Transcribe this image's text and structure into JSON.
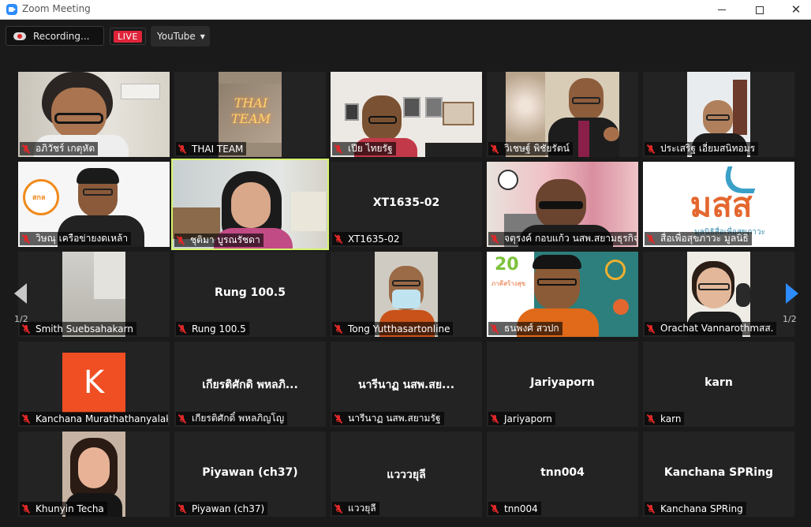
{
  "window": {
    "title": "Zoom Meeting"
  },
  "toolbar": {
    "recording": "Recording...",
    "live": "LIVE",
    "platform": "YouTube"
  },
  "pagination": {
    "left": "1/2",
    "right": "1/2"
  },
  "colors": {
    "active_speaker": "#d6f46b",
    "muted_mic": "#e02828",
    "live_badge": "#e0243a",
    "next_arrow": "#2d8cff"
  },
  "tiles": [
    {
      "name": "อภิวัชร์ เกตุหัต",
      "center": ""
    },
    {
      "name": "THAI TEAM",
      "center": ""
    },
    {
      "name": "เปีย ไทยรัฐ",
      "center": ""
    },
    {
      "name": "วิเชษฐ์ พิชัยรัตน์",
      "center": ""
    },
    {
      "name": "ประเสริฐ เอี่ยมสนิทอมร",
      "center": ""
    },
    {
      "name": "วิษณุ เครือข่ายงดเหล้า",
      "center": ""
    },
    {
      "name": "ชุติมา บูรณรัชดา",
      "center": ""
    },
    {
      "name": "XT1635-02",
      "center": "XT1635-02"
    },
    {
      "name": "จตุรงค์ กอบแก้ว นสพ.สยามธุรกิจ",
      "center": ""
    },
    {
      "name": "สื่อเพื่อสุขภาวะ มูลนิธิ",
      "center": ""
    },
    {
      "name": "Smith Suebsahakarn",
      "center": ""
    },
    {
      "name": "Rung 100.5",
      "center": "Rung 100.5"
    },
    {
      "name": "Tong Yutthasartonline",
      "center": ""
    },
    {
      "name": "ธนพงศ์ สวปก",
      "center": ""
    },
    {
      "name": "Orachat Vannarothmสส.",
      "center": ""
    },
    {
      "name": "Kanchana Murathathanyalak",
      "center": ""
    },
    {
      "name": "เกียรติศักดิ์ พหลภิญโญ",
      "center": "เกียรติศักดิ พหลภิ..."
    },
    {
      "name": "นารีนาฏ นสพ.สยามรัฐ",
      "center": "นารีนาฏ นสพ.สย..."
    },
    {
      "name": "Jariyaporn",
      "center": "Jariyaporn"
    },
    {
      "name": "karn",
      "center": "karn"
    },
    {
      "name": "Khunyin Techa",
      "center": ""
    },
    {
      "name": "Piyawan (ch37)",
      "center": "Piyawan (ch37)"
    },
    {
      "name": "แววยุลี",
      "center": "แวววยุลี"
    },
    {
      "name": "tnn004",
      "center": "tnn004"
    },
    {
      "name": "Kanchana SPRing",
      "center": "Kanchana SPRing"
    }
  ],
  "logos": {
    "thai_team": "THAI TEAM",
    "k_avatar": "K",
    "mosos": "มสส",
    "mosos_tag": "มูลนิธิสื่อเพื่อสุขภาวะ",
    "anniv_num": "20",
    "anniv_text": "ภาคีสร้างสุข",
    "sora": "สกล"
  }
}
